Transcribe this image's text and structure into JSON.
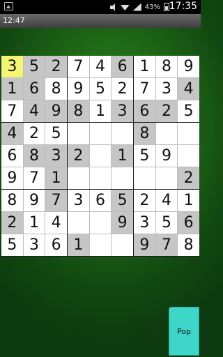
{
  "status_bar": {
    "time": "17:35",
    "battery_percent": "43%",
    "icons": [
      "image-icon",
      "mute-icon",
      "wifi-icon",
      "signal-icon",
      "battery-icon"
    ]
  },
  "timer": {
    "elapsed": "12:47"
  },
  "sudoku": {
    "selected_cell": [
      0,
      0
    ],
    "grid": [
      [
        "3",
        "5",
        "2",
        "7",
        "4",
        "6",
        "1",
        "8",
        "9"
      ],
      [
        "1",
        "6",
        "8",
        "9",
        "5",
        "2",
        "7",
        "3",
        "4"
      ],
      [
        "7",
        "4",
        "9",
        "8",
        "1",
        "3",
        "6",
        "2",
        "5"
      ],
      [
        "4",
        "2",
        "5",
        "",
        "",
        "",
        "8",
        "",
        ""
      ],
      [
        "6",
        "8",
        "3",
        "2",
        "",
        "1",
        "5",
        "9",
        ""
      ],
      [
        "9",
        "7",
        "1",
        "",
        "",
        "",
        "",
        "",
        "2"
      ],
      [
        "8",
        "9",
        "7",
        "3",
        "6",
        "5",
        "2",
        "4",
        "1"
      ],
      [
        "2",
        "1",
        "4",
        "",
        "",
        "9",
        "3",
        "5",
        "6"
      ],
      [
        "5",
        "3",
        "6",
        "1",
        "",
        "",
        "9",
        "7",
        "8"
      ]
    ],
    "given": [
      [
        0,
        1,
        1,
        0,
        0,
        1,
        0,
        0,
        0
      ],
      [
        1,
        1,
        0,
        0,
        0,
        0,
        0,
        0,
        1
      ],
      [
        0,
        1,
        1,
        1,
        0,
        1,
        1,
        1,
        0
      ],
      [
        1,
        0,
        0,
        0,
        0,
        0,
        1,
        0,
        0
      ],
      [
        0,
        1,
        1,
        1,
        0,
        1,
        0,
        0,
        0
      ],
      [
        0,
        0,
        1,
        0,
        0,
        0,
        0,
        0,
        1
      ],
      [
        0,
        0,
        1,
        0,
        0,
        1,
        0,
        0,
        0
      ],
      [
        1,
        0,
        0,
        0,
        0,
        1,
        0,
        0,
        1
      ],
      [
        0,
        0,
        0,
        1,
        0,
        0,
        1,
        1,
        0
      ]
    ]
  },
  "pop_button": {
    "label": "Pop"
  }
}
